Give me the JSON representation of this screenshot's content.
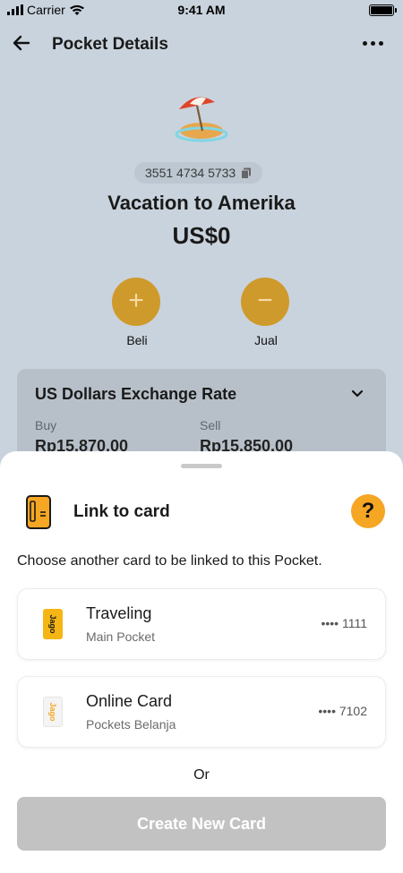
{
  "status_bar": {
    "carrier": "Carrier",
    "time": "9:41 AM"
  },
  "header": {
    "title": "Pocket Details"
  },
  "pocket": {
    "account_number": "3551 4734 5733",
    "name": "Vacation to Amerika",
    "balance": "US$0"
  },
  "actions": {
    "buy_label": "Beli",
    "sell_label": "Jual"
  },
  "exchange_rate": {
    "title": "US Dollars Exchange Rate",
    "buy_label": "Buy",
    "buy_value": "Rp15.870,00",
    "sell_label": "Sell",
    "sell_value": "Rp15.850,00"
  },
  "sheet": {
    "title": "Link to card",
    "help_label": "?",
    "description": "Choose another card to be linked to this Pocket.",
    "cards": [
      {
        "name": "Traveling",
        "pocket": "Main Pocket",
        "masked_number": "•••• 1111",
        "thumb_text": "Jago",
        "thumb_color": "#f5b515"
      },
      {
        "name": "Online Card",
        "pocket": "Pockets Belanja",
        "masked_number": "•••• 7102",
        "thumb_text": "Jago",
        "thumb_color": "#f4f4f4"
      }
    ],
    "or_label": "Or",
    "create_button": "Create New Card"
  },
  "colors": {
    "accent": "#f5a623",
    "action_circle": "#cf9a2c",
    "overlay_bg": "#c9d3dd",
    "disabled_button": "#c2c2c2"
  }
}
